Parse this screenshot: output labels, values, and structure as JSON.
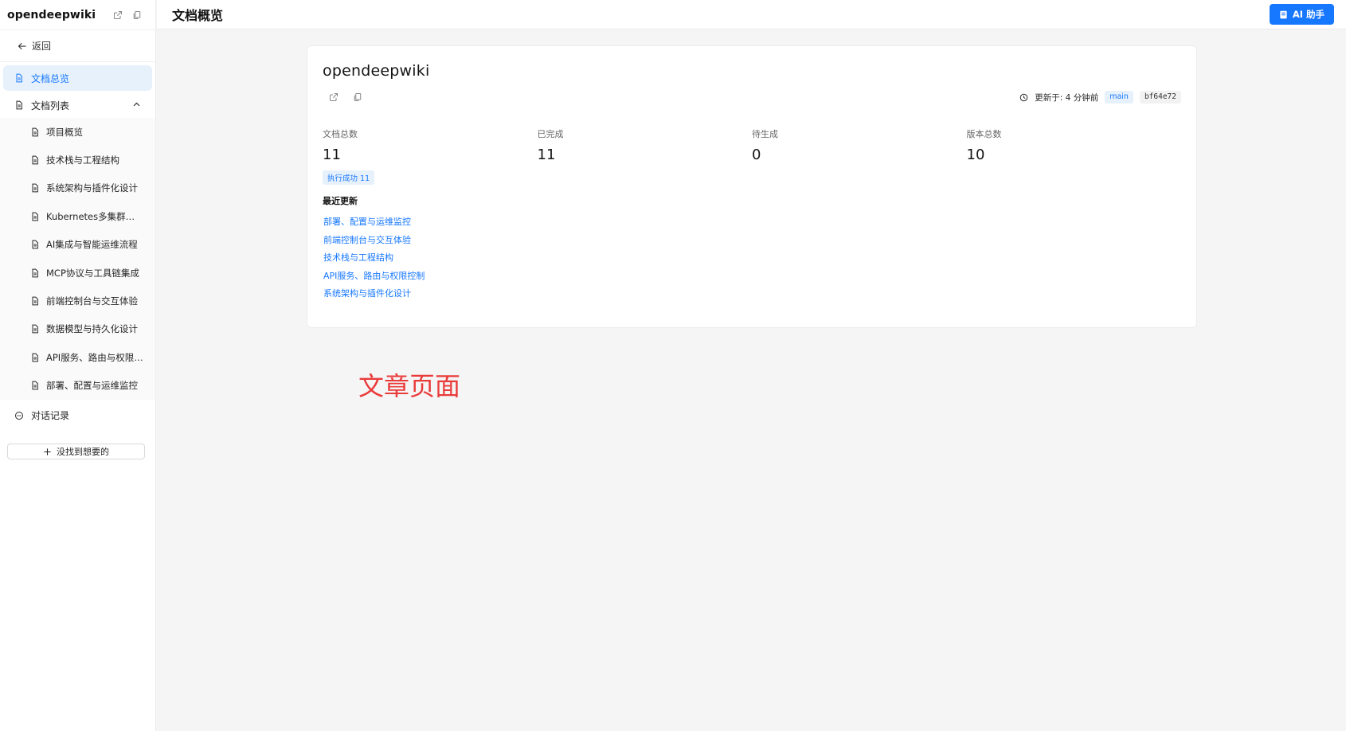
{
  "app": {
    "name": "opendeepwiki"
  },
  "sidebar": {
    "back_label": "返回",
    "overview_label": "文档总览",
    "list_label": "文档列表",
    "docs": [
      "项目概览",
      "技术栈与工程结构",
      "系统架构与插件化设计",
      "Kubernetes多集群管理与资源操作",
      "AI集成与智能运维流程",
      "MCP协议与工具链集成",
      "前端控制台与交互体验",
      "数据模型与持久化设计",
      "API服务、路由与权限控制",
      "部署、配置与运维监控"
    ],
    "chat_label": "对话记录",
    "add_label": "没找到想要的"
  },
  "header": {
    "title": "文档概览",
    "ai_label": "AI 助手"
  },
  "card": {
    "title": "opendeepwiki",
    "updated": "更新于: 4 分钟前",
    "branch": "main",
    "commit": "bf64e72",
    "stats": [
      {
        "label": "文档总数",
        "value": "11"
      },
      {
        "label": "已完成",
        "value": "11"
      },
      {
        "label": "待生成",
        "value": "0"
      },
      {
        "label": "版本总数",
        "value": "10"
      }
    ],
    "success_badge": "执行成功 11",
    "recent_title": "最近更新",
    "recent": [
      "部署、配置与运维监控",
      "前端控制台与交互体验",
      "技术栈与工程结构",
      "API服务、路由与权限控制",
      "系统架构与插件化设计"
    ]
  },
  "annotation": "文章页面",
  "colors": {
    "accent": "#1677ff",
    "annotation": "#ea3b3b"
  }
}
